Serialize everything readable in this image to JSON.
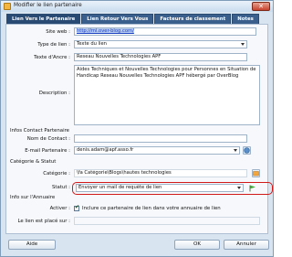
{
  "window": {
    "title": "Modifier le lien partenaire",
    "close_symbol": "✕"
  },
  "tabs": [
    {
      "label": "Lien Vers le Partenaire"
    },
    {
      "label": "Lien Retour Vers Vous"
    },
    {
      "label": "Facteurs de classement"
    },
    {
      "label": "Notes"
    }
  ],
  "form": {
    "site_web": {
      "label": "Site web :",
      "value": "http://ml.over-blog.com/"
    },
    "type_lien": {
      "label": "Type de lien :",
      "value": "Texte du lien"
    },
    "texte_ancre": {
      "label": "Texte d'Ancre :",
      "value": "Reseau Nouvelles Technologies APF"
    },
    "description": {
      "label": "Description :",
      "lines": [
        "Aides Techniques et Nouvelles Technologies pour Personnes en Situation de",
        "Handicap Reseau Nouvelles Technologies APF hébergé par OverBlog"
      ]
    }
  },
  "contact_section": {
    "title": "Infos Contact Partenaire",
    "nom": {
      "label": "Nom de Contact :",
      "value": ""
    },
    "email": {
      "label": "E-mail Partenaire :",
      "value": "denis.adam@apf.asso.fr"
    }
  },
  "category_section": {
    "title": "Catégorie & Statut",
    "categorie": {
      "label": "Catégorie :",
      "value": "\\fa Catégorie\\Blogs\\hautes technologies"
    },
    "statut": {
      "label": "Statut :",
      "value": "Envoyer un mail de requête de lien"
    }
  },
  "annuaire_section": {
    "title": "Info sur l'Annuaire",
    "activer": {
      "label": "Activer :",
      "checkbox_label": "Inclure ce partenaire de lien dans votre annuaire de lien"
    },
    "lien_place": {
      "label": "Le lien est placé sur :"
    }
  },
  "buttons": {
    "aide": "Aide",
    "ok": "OK",
    "annuler": "Annuler"
  },
  "colors": {
    "tab_bg": "#3a5f8c",
    "highlight": "#d01919",
    "window_bg": "#d8e4f0"
  }
}
